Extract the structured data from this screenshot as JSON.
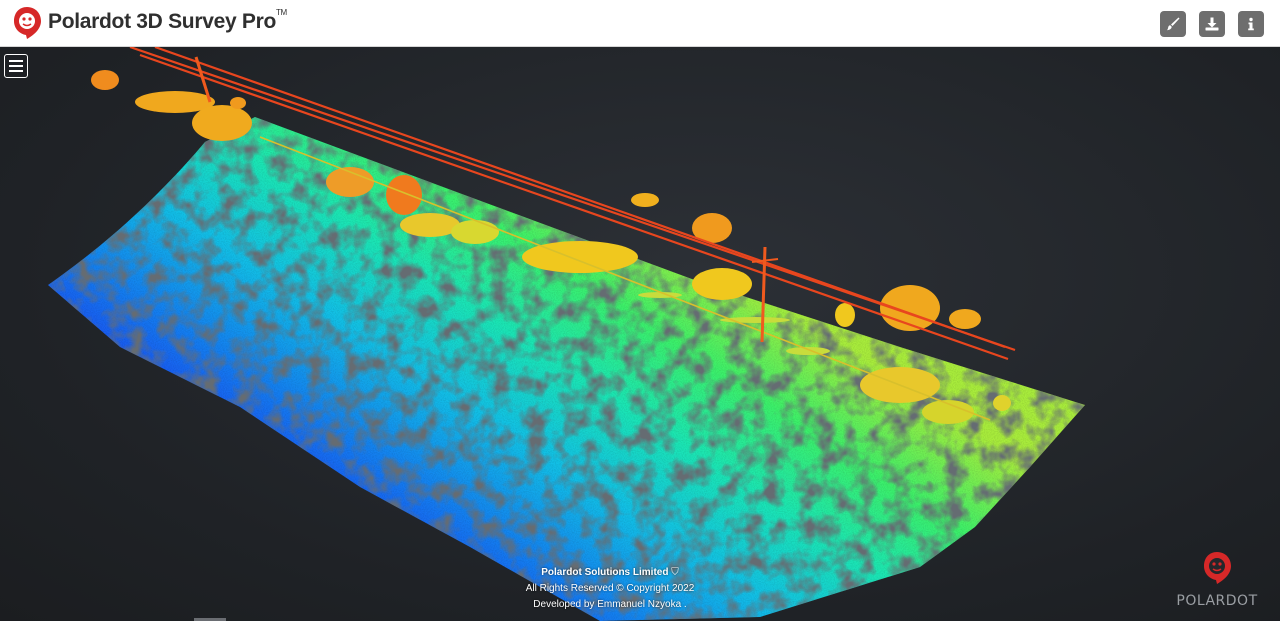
{
  "header": {
    "app_title": "Polardot 3D Survey Pro",
    "trademark": "TM",
    "logo_icon": "polardot-logo-icon"
  },
  "toolbar": {
    "items": [
      {
        "name": "edit",
        "icon": "brush-icon"
      },
      {
        "name": "download",
        "icon": "download-icon"
      },
      {
        "name": "info",
        "icon": "info-icon"
      }
    ]
  },
  "viewer": {
    "menu_icon": "hamburger-menu-icon",
    "colormap": [
      "#3a00c8",
      "#1f3cf0",
      "#12a6f0",
      "#1be6c8",
      "#3cf06a",
      "#c8e83c",
      "#f0c81e",
      "#f08c1e",
      "#e8461e"
    ]
  },
  "footer": {
    "company": "Polardot Solutions Limited",
    "rights": "All Rights Reserved © Copyright 2022",
    "developer": "Developed by Emmanuel Nzyoka ."
  },
  "brand": {
    "name": "POLARDOT",
    "color": "#d62828"
  }
}
